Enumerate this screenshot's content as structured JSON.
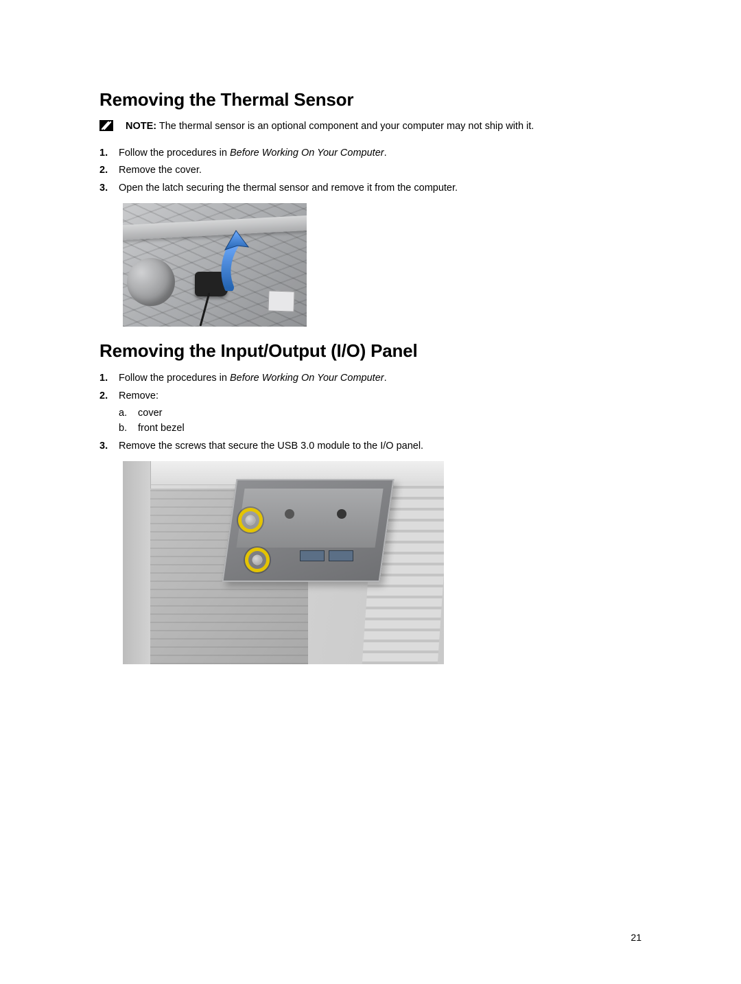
{
  "page_number": "21",
  "section1": {
    "heading": "Removing the Thermal Sensor",
    "note_label": "NOTE:",
    "note_text": " The thermal sensor is an optional component and your computer may not ship with it.",
    "steps": {
      "s1_pre": "Follow the procedures in ",
      "s1_em": "Before Working On Your Computer",
      "s1_post": ".",
      "s2": "Remove the cover.",
      "s3": "Open the latch securing the thermal sensor and remove it from the computer."
    }
  },
  "section2": {
    "heading": "Removing the Input/Output (I/O) Panel",
    "steps": {
      "s1_pre": "Follow the procedures in ",
      "s1_em": "Before Working On Your Computer",
      "s1_post": ".",
      "s2": "Remove:",
      "s2a": "cover",
      "s2b": "front bezel",
      "s3": "Remove the screws that secure the USB 3.0 module to the I/O panel."
    }
  }
}
